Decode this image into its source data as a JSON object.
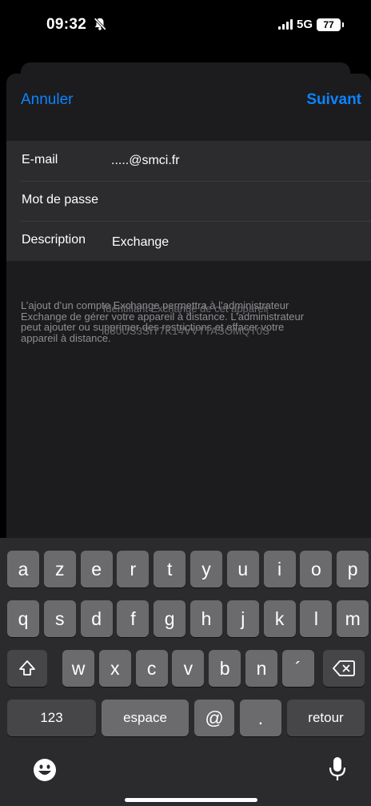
{
  "status_bar": {
    "time": "09:32",
    "network": "5G",
    "battery": "77"
  },
  "nav": {
    "cancel": "Annuler",
    "next": "Suivant"
  },
  "form": {
    "email_label": "E-mail",
    "email_value": ".....@smci.fr",
    "password_label": "Mot de passe",
    "password_value": "",
    "description_label": "Description",
    "description_value": "Exchange"
  },
  "footer": {
    "note_line1": "L’ajout d’un compte Exchange permettra à l’administrateur",
    "note_line2": "Exchange de gérer votre appareil à distance. L’administrateur",
    "note_line3": "peut ajouter ou supprimer des restrictions et effacer votre",
    "note_line4": "appareil à distance.",
    "device_id_label": "Identifiant Exchange de cet appareil",
    "device_id_value": "IJ30US3SIT7K14VVTTASOMQT0S"
  },
  "keyboard": {
    "row1": [
      "a",
      "z",
      "e",
      "r",
      "t",
      "y",
      "u",
      "i",
      "o",
      "p"
    ],
    "row2": [
      "q",
      "s",
      "d",
      "f",
      "g",
      "h",
      "j",
      "k",
      "l",
      "m"
    ],
    "row3": [
      "w",
      "x",
      "c",
      "v",
      "b",
      "n",
      "´"
    ],
    "numbers_key": "123",
    "space_key": "espace",
    "at_key": "@",
    "dot_key": ".",
    "return_key": "retour",
    "shift_icon": "shift-icon",
    "delete_icon": "delete-icon",
    "emoji_icon": "emoji-icon",
    "mic_icon": "microphone-icon"
  }
}
